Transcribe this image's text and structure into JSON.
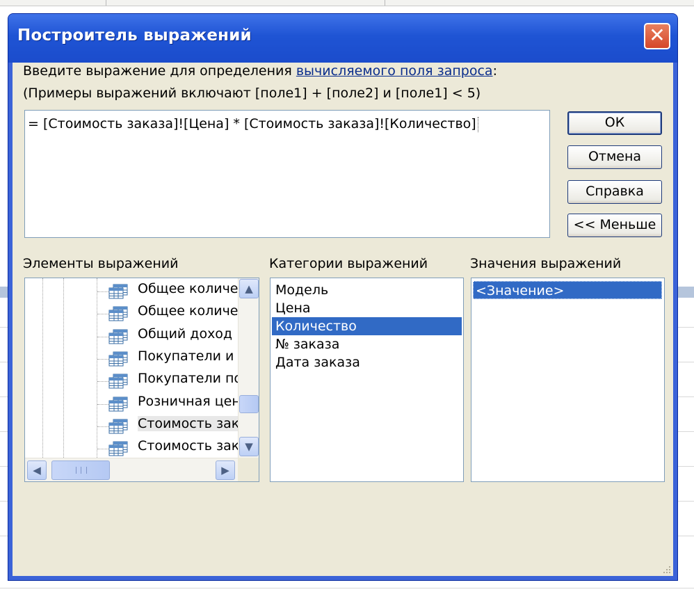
{
  "dialog": {
    "title": "Построитель выражений",
    "close_symbol": "✕"
  },
  "description": {
    "line1_prefix": "Введите выражение для определения ",
    "line1_link": "вычисляемого поля запроса",
    "line1_suffix": ":",
    "line2": "(Примеры выражений включают [поле1] + [поле2] и [поле1] < 5)"
  },
  "expression": {
    "value": "= [Стоимость заказа]![Цена] * [Стоимость заказа]![Количество]"
  },
  "buttons": {
    "ok": "ОК",
    "cancel": "Отмена",
    "help": "Справка",
    "less": "<< Меньше"
  },
  "panes": {
    "elements_label": "Элементы выражений",
    "categories_label": "Категории выражений",
    "values_label": "Значения выражений"
  },
  "elements_tree": [
    {
      "label": "Общее количе",
      "selected": false
    },
    {
      "label": "Общее количе",
      "selected": false
    },
    {
      "label": "Общий доход",
      "selected": false
    },
    {
      "label": "Покупатели и",
      "selected": false
    },
    {
      "label": "Покупатели по",
      "selected": false
    },
    {
      "label": "Розничная цен",
      "selected": false
    },
    {
      "label": "Стоимость зак",
      "selected": true
    },
    {
      "label": "Стоимость зак",
      "selected": false
    }
  ],
  "categories": [
    {
      "label": "Модель",
      "selected": false
    },
    {
      "label": "Цена",
      "selected": false
    },
    {
      "label": "Количество",
      "selected": true
    },
    {
      "label": "№ заказа",
      "selected": false
    },
    {
      "label": "Дата заказа",
      "selected": false
    }
  ],
  "values": [
    {
      "label": "<Значение>",
      "selected": true
    }
  ],
  "icons": {
    "close": "close-icon",
    "query": "query-table-icon",
    "scroll_up": "▲",
    "scroll_down": "▼",
    "scroll_left": "◀",
    "scroll_right": "▶"
  },
  "colors": {
    "title_bar": "#1f54d4",
    "selection": "#316ac5",
    "dialog_face": "#ece9d8"
  }
}
